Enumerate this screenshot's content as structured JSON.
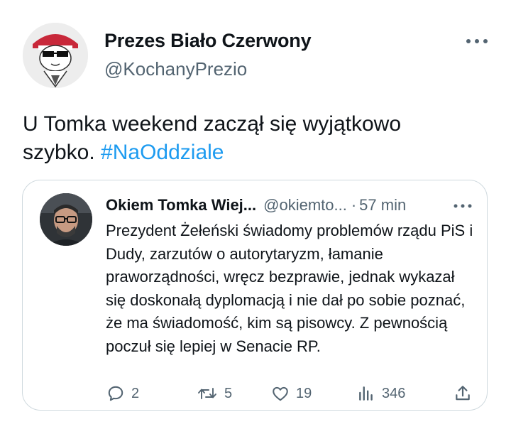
{
  "tweet": {
    "author_name": "Prezes Biało Czerwony",
    "author_handle": "@KochanyPrezio",
    "text": "U Tomka weekend zaczął się wyjątkowo szybko. ",
    "hashtag": "#NaOddziale",
    "more_icon": "more-horizontal-icon"
  },
  "quote": {
    "author_name": "Okiem Tomka Wiej...",
    "author_handle": "@okiemto...",
    "separator": "·",
    "time": "57 min",
    "text": "Prezydent Żełeński świadomy problemów rządu PiS i Dudy, zarzutów o autorytaryzm, łamanie praworządności, wręcz bezprawie, jednak wykazał się doskonałą dyplomacją i nie dał po sobie poznać, że ma świadomość, kim są pisowcy. Z pewnością poczuł się lepiej w Senacie RP.",
    "actions": {
      "replies": "2",
      "retweets": "5",
      "likes": "19",
      "views": "346"
    }
  },
  "colors": {
    "text": "#0f1419",
    "secondary": "#536471",
    "link": "#1d9bf0",
    "border": "#cfd9de"
  }
}
